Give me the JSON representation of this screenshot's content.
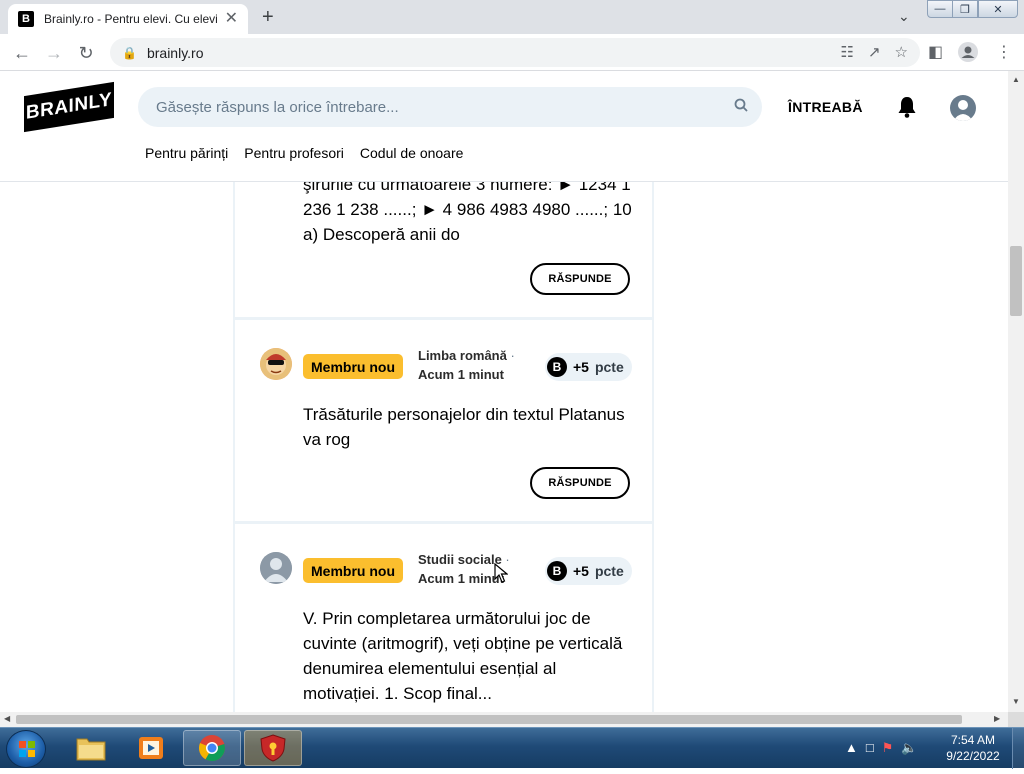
{
  "browser": {
    "tab_title": "Brainly.ro - Pentru elevi. Cu elevi.",
    "tab_favicon": "B",
    "tab_close": "✕",
    "new_tab": "+",
    "url": "brainly.ro",
    "window_controls": {
      "minimize": "—",
      "maximize": "❐",
      "close": "✕"
    }
  },
  "site": {
    "logo": "BRAINLY",
    "search_placeholder": "Găsește răspuns la orice întrebare...",
    "ask_label": "ÎNTREABĂ",
    "nav": [
      "Pentru părinți",
      "Pentru profesori",
      "Codul de onoare"
    ]
  },
  "questions": [
    {
      "text": "şirurile cu următoarele 3 numere: ► 1234 1 236 1 238 ......; ► 4 986 4983 4980 ......; 10 a) Descoperă anii do",
      "reply_label": "RĂSPUNDE"
    },
    {
      "badge": "Membru nou",
      "subject": "Limba română",
      "time": "Acum 1 minut",
      "points_value": "+5",
      "points_unit": "pcte",
      "text": "Trăsăturile personajelor din textul Platanus va rog",
      "reply_label": "RĂSPUNDE",
      "avatar": "cartoon-avatar"
    },
    {
      "badge": "Membru nou",
      "subject": "Studii sociale",
      "time": "Acum 1 minut",
      "points_value": "+5",
      "points_unit": "pcte",
      "text": "V. Prin completarea următorului joc de cuvinte (aritmogrif), veți obține pe verticală denumirea elementului esențial al motivației. 1. Scop final...",
      "avatar": "default-user-avatar"
    }
  ],
  "taskbar": {
    "time": "7:54 AM",
    "date": "9/22/2022"
  },
  "colors": {
    "badge": "#fbbe2e",
    "search_bg": "#ebf2f7",
    "taskbar": "#1f4a77"
  }
}
